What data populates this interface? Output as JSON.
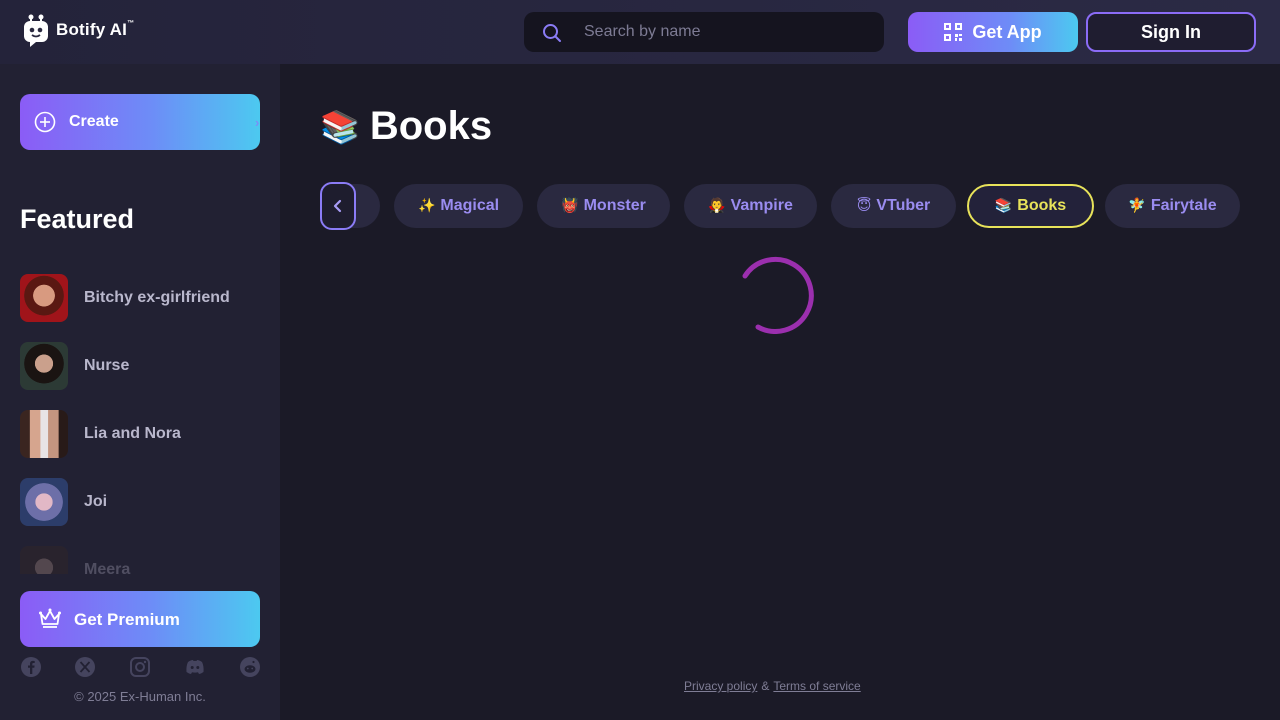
{
  "header": {
    "logo_text": "Botify AI",
    "logo_tm": "™",
    "search_placeholder": "Search by name",
    "get_app_label": "Get App",
    "sign_in_label": "Sign In"
  },
  "sidebar": {
    "create_label": "Create",
    "featured_title": "Featured",
    "featured": [
      {
        "name": "Bitchy ex-girlfriend"
      },
      {
        "name": "Nurse"
      },
      {
        "name": "Lia and Nora"
      },
      {
        "name": "Joi"
      },
      {
        "name": "Meera"
      }
    ],
    "premium_label": "Get Premium",
    "socials": [
      "facebook-icon",
      "x-icon",
      "instagram-icon",
      "discord-icon",
      "reddit-icon"
    ],
    "copyright": "© 2025 Ex-Human Inc."
  },
  "main": {
    "title_emoji": "📚",
    "title": "Books",
    "tabs": [
      {
        "emoji": "✨",
        "label": "Magical"
      },
      {
        "emoji": "👹",
        "label": "Monster"
      },
      {
        "emoji": "🧛",
        "label": "Vampire"
      },
      {
        "emoji": "😇",
        "label": "VTuber"
      },
      {
        "emoji": "📚",
        "label": "Books",
        "active": true
      },
      {
        "emoji": "🧚",
        "label": "Fairytale"
      }
    ],
    "loading": true
  },
  "footer": {
    "privacy": "Privacy policy",
    "amp": "&",
    "terms": "Terms of service"
  },
  "colors": {
    "background": "#1b1a27",
    "sidebar": "#222133",
    "accent_gradient_start": "#8b5cf6",
    "accent_gradient_end": "#4cc9f0",
    "active_tab": "#e8e35a",
    "tab_text": "#9a8cf0",
    "spinner": "#9b2fae"
  }
}
